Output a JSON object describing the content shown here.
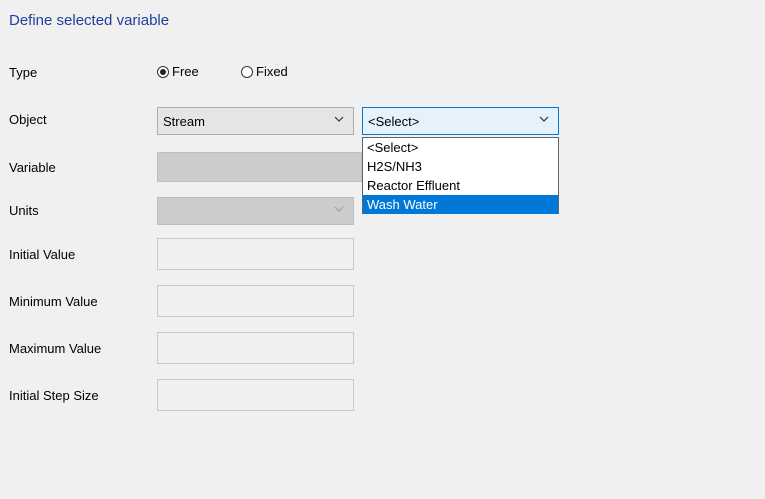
{
  "title": "Define selected variable",
  "labels": {
    "type": "Type",
    "object": "Object",
    "variable": "Variable",
    "units": "Units",
    "initial_value": "Initial Value",
    "minimum_value": "Minimum Value",
    "maximum_value": "Maximum Value",
    "initial_step_size": "Initial Step Size"
  },
  "type_options": {
    "free": "Free",
    "fixed": "Fixed",
    "selected": "Free"
  },
  "object_combo": {
    "value": "Stream"
  },
  "stream_combo": {
    "value": "<Select>",
    "options": [
      "<Select>",
      "H2S/NH3",
      "Reactor Effluent",
      "Wash Water"
    ],
    "highlighted": "Wash Water"
  },
  "colors": {
    "title": "#1e3f9c",
    "highlight": "#0078d7",
    "background": "#f0f0f0"
  }
}
